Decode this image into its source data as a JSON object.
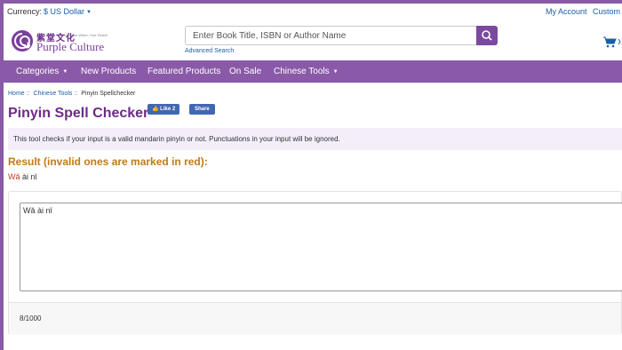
{
  "topbar": {
    "currency_label": "Currency:",
    "currency_value": "$ US Dollar",
    "my_account": "My Account",
    "customer": "Custom"
  },
  "header": {
    "logo_cn": "紫堂文化",
    "logo_tagline": "A Chinese Within Your Reach",
    "logo_name": "Purple Culture",
    "search_placeholder": "Enter Book Title, ISBN or Author Name",
    "advanced_search": "Advanced Search"
  },
  "nav": {
    "items": [
      {
        "label": "Categories",
        "dropdown": true
      },
      {
        "label": "New Products",
        "dropdown": false
      },
      {
        "label": "Featured Products",
        "dropdown": false
      },
      {
        "label": "On Sale",
        "dropdown": false
      },
      {
        "label": "Chinese Tools",
        "dropdown": true
      }
    ]
  },
  "breadcrumb": {
    "home": "Home",
    "tools": "Chinese Tools",
    "current": "Pinyin Spellchecker"
  },
  "page": {
    "title": "Pinyin Spell Checker",
    "fb_like": "Like 2",
    "fb_share": "Share",
    "info": "This tool checks if your input is a valid mandarin pinyin or not. Punctuations in your input will be ignored.",
    "result_heading": "Result (invalid ones are marked in red):",
    "result_invalid": "Wǎ",
    "result_valid": " ài nǐ",
    "textarea_value": "Wǎ ài nǐ",
    "char_count": "8/1000"
  },
  "colors": {
    "brand_purple": "#8a5aa8",
    "title_purple": "#6e2a86",
    "result_orange": "#c07a1a",
    "invalid_red": "#c0392b",
    "link_blue": "#1a5fa8"
  }
}
